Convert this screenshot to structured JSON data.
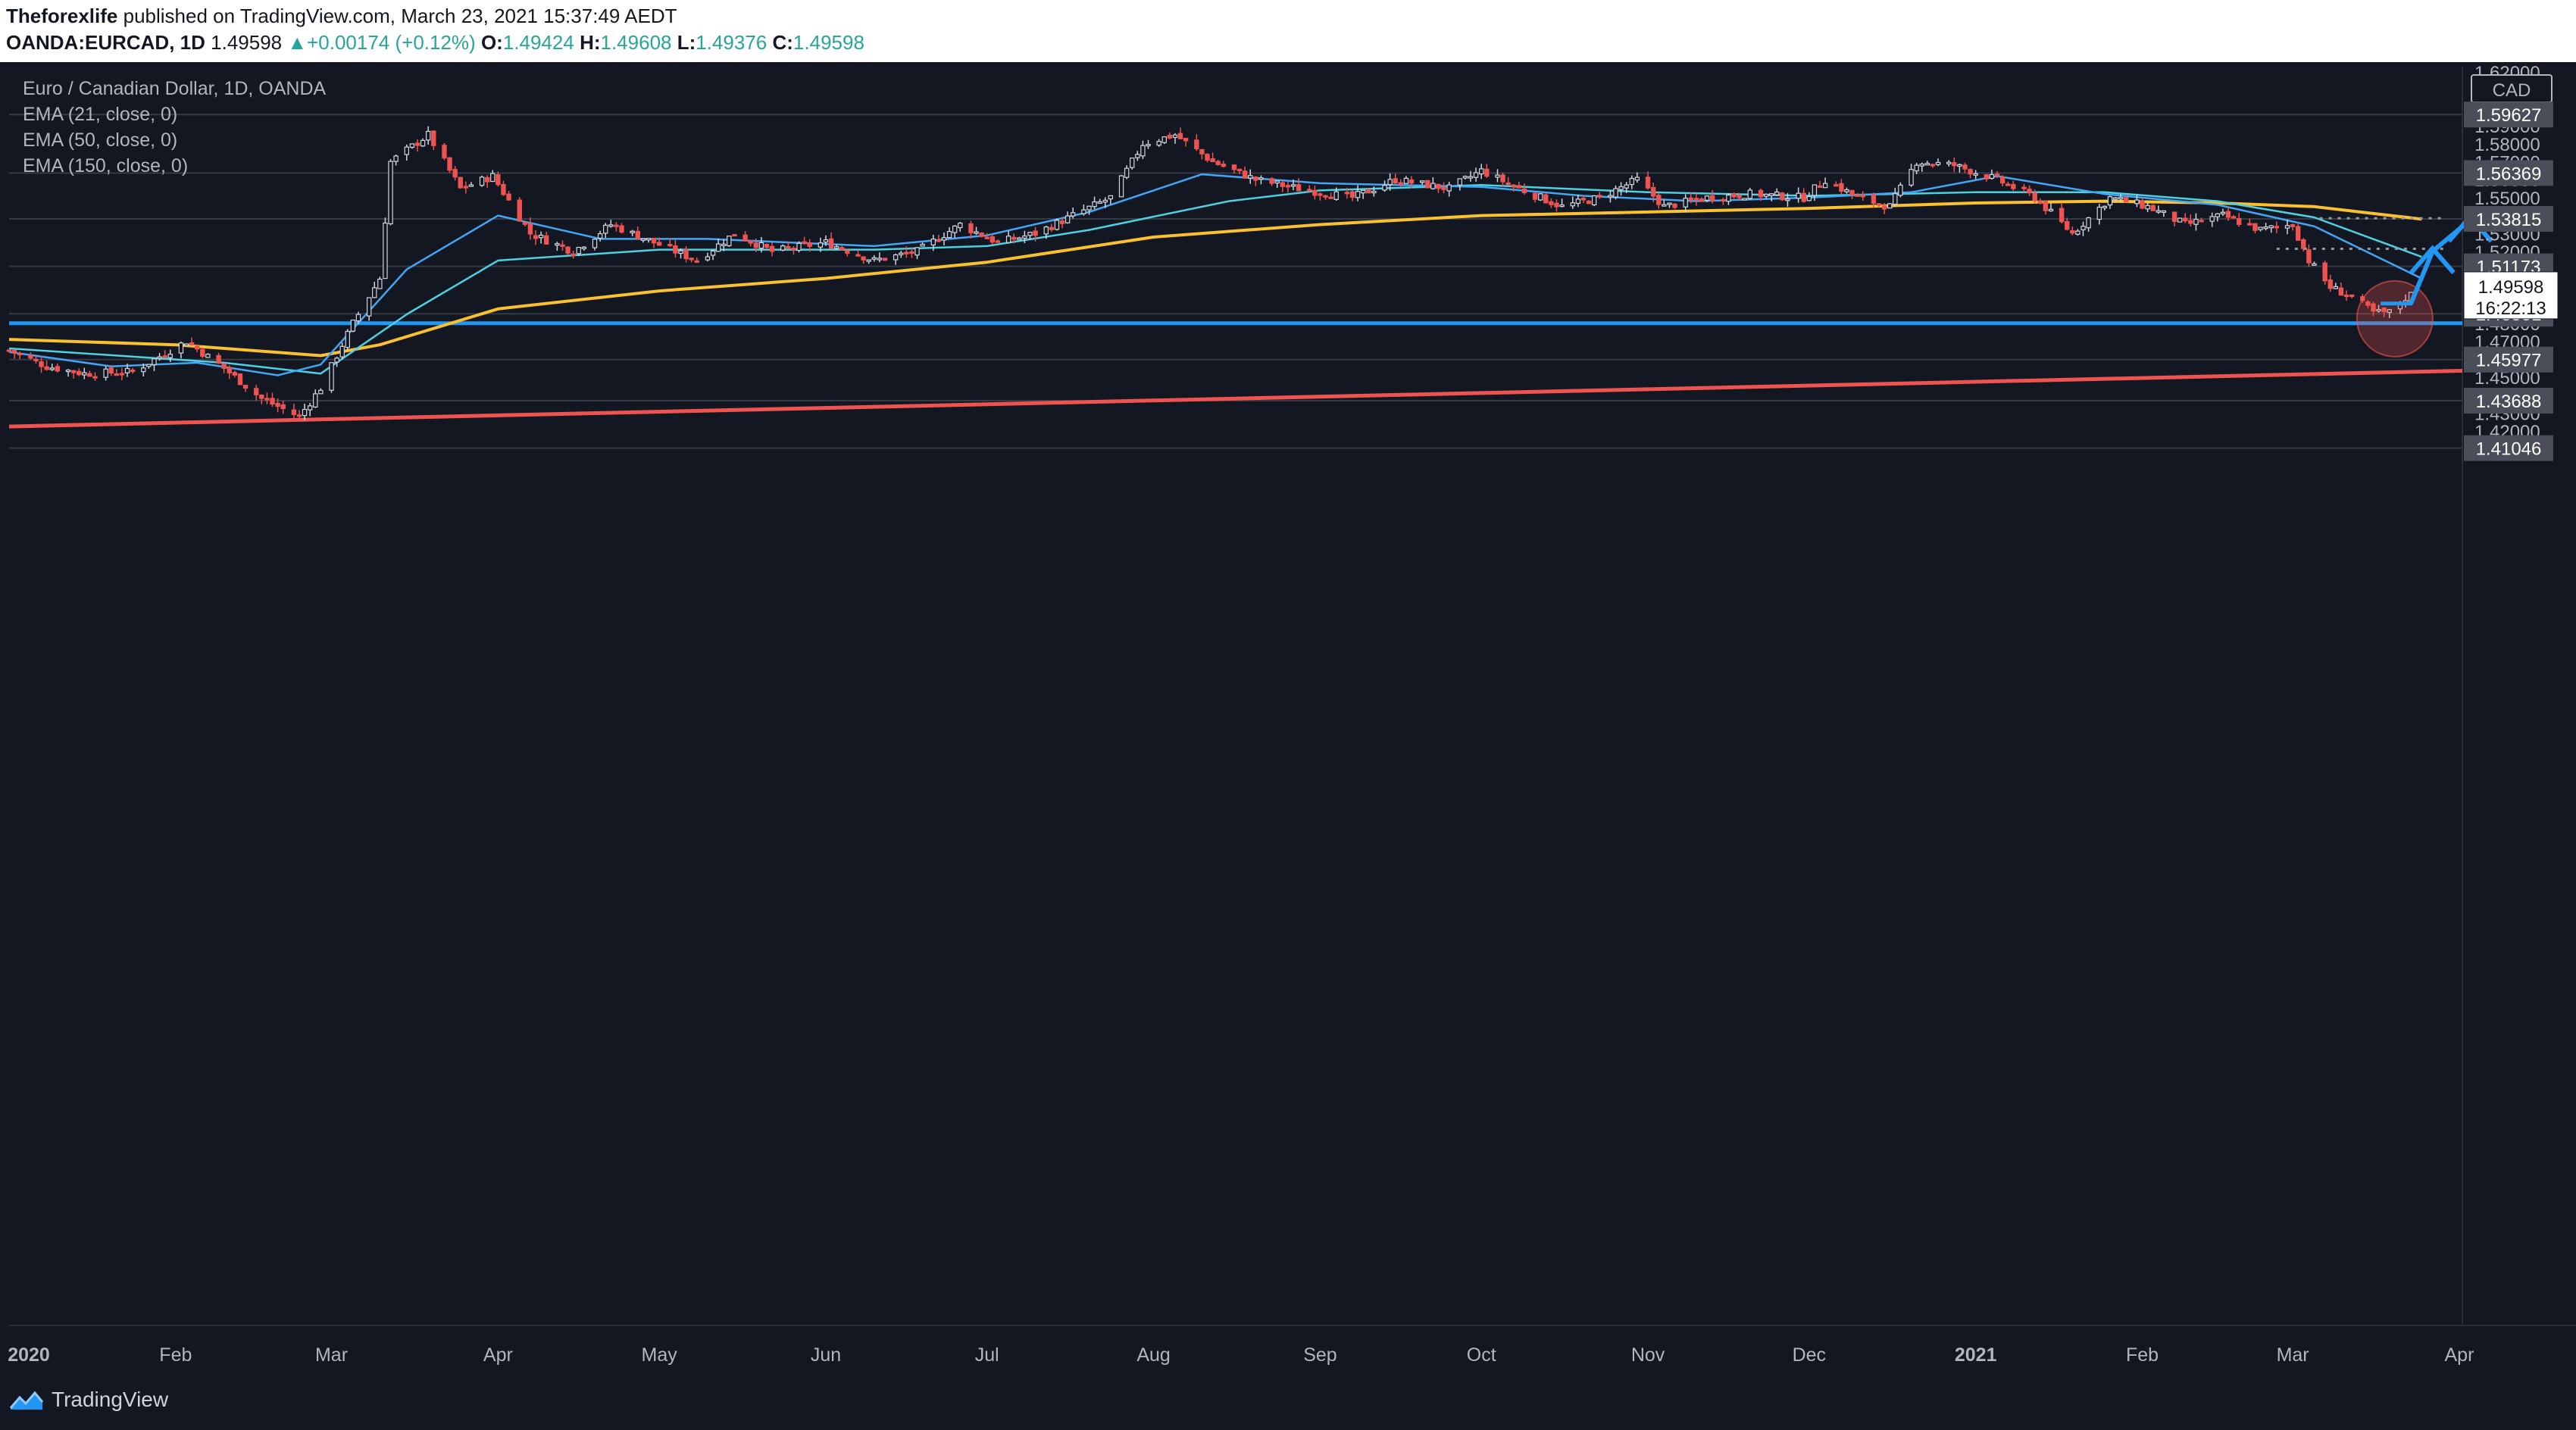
{
  "header": {
    "publisher": "Theforexlife",
    "published_text": "published on TradingView.com, March 23, 2021 15:37:49 AEDT",
    "symbol": "OANDA:EURCAD, 1D",
    "last": "1.49598",
    "change": "+0.00174 (+0.12%)",
    "o_label": "O:",
    "o": "1.49424",
    "h_label": "H:",
    "h": "1.49608",
    "l_label": "L:",
    "l": "1.49376",
    "c_label": "C:",
    "c": "1.49598"
  },
  "legend": {
    "title": "Euro / Canadian Dollar, 1D, OANDA",
    "ema21": "EMA (21, close, 0)",
    "ema50": "EMA (50, close, 0)",
    "ema150": "EMA (150, close, 0)"
  },
  "footer": {
    "brand": "TradingView"
  },
  "colors": {
    "background": "#131722",
    "up": "#d1d4dc",
    "down": "#ef5350",
    "ema21": "#42a5f5",
    "ema50": "#4dd0e1",
    "ema150": "#fbc02d",
    "support": "#2196f3",
    "trendline": "#ef5350",
    "arrow": "#2196f3"
  },
  "chart_data": {
    "type": "candlestick",
    "title": "Euro / Canadian Dollar, 1D, OANDA",
    "currency": "CAD",
    "ylim": [
      1.41,
      1.62
    ],
    "y_ticks": [
      1.42,
      1.43,
      1.44,
      1.45,
      1.46,
      1.47,
      1.48,
      1.49,
      1.5,
      1.51,
      1.52,
      1.53,
      1.54,
      1.55,
      1.56,
      1.57,
      1.58,
      1.59,
      1.6,
      1.61,
      1.62
    ],
    "y_tick_labels": [
      "1.42000",
      "1.43000",
      "1.44000",
      "1.45000",
      "1.46000",
      "1.47000",
      "1.48000",
      "1.49000",
      "1.50000",
      "1.51000",
      "1.52000",
      "1.53000",
      "1.54000",
      "1.55000",
      "1.56000",
      "1.57000",
      "1.58000",
      "1.59000",
      "1.60000",
      "1.61000",
      "1.62000"
    ],
    "x_ticks": [
      "2020",
      "Feb",
      "Mar",
      "Apr",
      "May",
      "Jun",
      "Jul",
      "Aug",
      "Sep",
      "Oct",
      "Nov",
      "Dec",
      "2021",
      "Feb",
      "Mar",
      "Apr"
    ],
    "x_range": [
      "2020-01-01",
      "2021-04-30"
    ],
    "price_levels": [
      {
        "label": "1.59627",
        "value": 1.59627
      },
      {
        "label": "1.56369",
        "value": 1.56369
      },
      {
        "label": "1.53815",
        "value": 1.53815
      },
      {
        "label": "1.51173",
        "value": 1.51173
      },
      {
        "label": "1.48531",
        "value": 1.48531
      },
      {
        "label": "1.45977",
        "value": 1.45977
      },
      {
        "label": "1.43688",
        "value": 1.43688
      },
      {
        "label": "1.41046",
        "value": 1.41046
      }
    ],
    "current_price": {
      "label": "1.49598",
      "value": 1.49598,
      "countdown": "16:22:13"
    },
    "support_line": 1.48,
    "trendline": {
      "start": [
        "2020-01-01",
        1.4225
      ],
      "end": [
        "2021-04-30",
        1.4555
      ]
    },
    "target_arrows": [
      {
        "from": [
          "2021-03-23",
          1.491
        ],
        "to": [
          "2021-03-27",
          1.52
        ]
      },
      {
        "to": [
          "2021-04-03",
          1.5375
        ]
      }
    ],
    "dotted_levels": [
      {
        "value": 1.5385,
        "from": "2021-03-06",
        "to": "2021-03-29"
      },
      {
        "value": 1.5215,
        "from": "2021-02-26",
        "to": "2021-03-29"
      }
    ],
    "highlight": {
      "date": "2021-03-20",
      "value": 1.4825
    },
    "series": [
      {
        "name": "EMA (21, close, 0)",
        "values": [
          [
            "2020-01-01",
            1.464
          ],
          [
            "2020-01-20",
            1.456
          ],
          [
            "2020-02-05",
            1.458
          ],
          [
            "2020-02-20",
            1.451
          ],
          [
            "2020-02-28",
            1.457
          ],
          [
            "2020-03-15",
            1.51
          ],
          [
            "2020-04-01",
            1.54
          ],
          [
            "2020-04-20",
            1.527
          ],
          [
            "2020-05-10",
            1.527
          ],
          [
            "2020-06-10",
            1.523
          ],
          [
            "2020-07-01",
            1.529
          ],
          [
            "2020-07-20",
            1.542
          ],
          [
            "2020-08-10",
            1.563
          ],
          [
            "2020-09-01",
            1.558
          ],
          [
            "2020-10-01",
            1.556
          ],
          [
            "2020-10-20",
            1.551
          ],
          [
            "2020-11-10",
            1.548
          ],
          [
            "2020-12-01",
            1.55
          ],
          [
            "2020-12-20",
            1.553
          ],
          [
            "2021-01-05",
            1.562
          ],
          [
            "2021-01-25",
            1.552
          ],
          [
            "2021-02-15",
            1.546
          ],
          [
            "2021-03-05",
            1.534
          ],
          [
            "2021-03-25",
            1.505
          ]
        ]
      },
      {
        "name": "EMA (50, close, 0)",
        "values": [
          [
            "2020-01-01",
            1.466
          ],
          [
            "2020-02-10",
            1.458
          ],
          [
            "2020-02-28",
            1.452
          ],
          [
            "2020-03-15",
            1.485
          ],
          [
            "2020-04-01",
            1.515
          ],
          [
            "2020-05-01",
            1.521
          ],
          [
            "2020-06-10",
            1.521
          ],
          [
            "2020-07-01",
            1.523
          ],
          [
            "2020-07-20",
            1.532
          ],
          [
            "2020-08-15",
            1.548
          ],
          [
            "2020-09-01",
            1.554
          ],
          [
            "2020-10-01",
            1.557
          ],
          [
            "2020-11-01",
            1.553
          ],
          [
            "2020-12-01",
            1.551
          ],
          [
            "2021-01-01",
            1.553
          ],
          [
            "2021-01-25",
            1.553
          ],
          [
            "2021-02-15",
            1.548
          ],
          [
            "2021-03-05",
            1.539
          ],
          [
            "2021-03-25",
            1.517
          ]
        ]
      },
      {
        "name": "EMA (150, close, 0)",
        "values": [
          [
            "2020-01-01",
            1.471
          ],
          [
            "2020-02-01",
            1.468
          ],
          [
            "2020-02-28",
            1.462
          ],
          [
            "2020-03-10",
            1.468
          ],
          [
            "2020-04-01",
            1.488
          ],
          [
            "2020-05-01",
            1.498
          ],
          [
            "2020-06-01",
            1.505
          ],
          [
            "2020-07-01",
            1.514
          ],
          [
            "2020-08-01",
            1.528
          ],
          [
            "2020-09-01",
            1.535
          ],
          [
            "2020-10-01",
            1.54
          ],
          [
            "2020-11-01",
            1.542
          ],
          [
            "2020-12-01",
            1.544
          ],
          [
            "2021-01-01",
            1.547
          ],
          [
            "2021-01-25",
            1.548
          ],
          [
            "2021-02-15",
            1.547
          ],
          [
            "2021-03-05",
            1.545
          ],
          [
            "2021-03-25",
            1.538
          ]
        ]
      }
    ],
    "candle_anchors": [
      [
        "2020-01-01",
        1.465
      ],
      [
        "2020-01-08",
        1.456
      ],
      [
        "2020-01-15",
        1.452
      ],
      [
        "2020-01-24",
        1.453
      ],
      [
        "2020-02-03",
        1.47
      ],
      [
        "2020-02-10",
        1.455
      ],
      [
        "2020-02-17",
        1.438
      ],
      [
        "2020-02-24",
        1.428
      ],
      [
        "2020-02-28",
        1.444
      ],
      [
        "2020-03-05",
        1.48
      ],
      [
        "2020-03-10",
        1.505
      ],
      [
        "2020-03-12",
        1.57
      ],
      [
        "2020-03-19",
        1.585
      ],
      [
        "2020-03-25",
        1.555
      ],
      [
        "2020-03-31",
        1.562
      ],
      [
        "2020-04-07",
        1.53
      ],
      [
        "2020-04-15",
        1.52
      ],
      [
        "2020-04-22",
        1.535
      ],
      [
        "2020-04-30",
        1.525
      ],
      [
        "2020-05-08",
        1.515
      ],
      [
        "2020-05-15",
        1.53
      ],
      [
        "2020-05-22",
        1.52
      ],
      [
        "2020-06-01",
        1.525
      ],
      [
        "2020-06-10",
        1.515
      ],
      [
        "2020-06-18",
        1.52
      ],
      [
        "2020-06-26",
        1.535
      ],
      [
        "2020-07-03",
        1.525
      ],
      [
        "2020-07-10",
        1.53
      ],
      [
        "2020-07-17",
        1.54
      ],
      [
        "2020-07-24",
        1.55
      ],
      [
        "2020-07-30",
        1.58
      ],
      [
        "2020-08-05",
        1.585
      ],
      [
        "2020-08-12",
        1.57
      ],
      [
        "2020-08-20",
        1.56
      ],
      [
        "2020-08-28",
        1.555
      ],
      [
        "2020-09-07",
        1.55
      ],
      [
        "2020-09-15",
        1.56
      ],
      [
        "2020-09-25",
        1.555
      ],
      [
        "2020-10-01",
        1.565
      ],
      [
        "2020-10-08",
        1.555
      ],
      [
        "2020-10-16",
        1.545
      ],
      [
        "2020-10-23",
        1.55
      ],
      [
        "2020-10-30",
        1.56
      ],
      [
        "2020-11-04",
        1.545
      ],
      [
        "2020-11-12",
        1.55
      ],
      [
        "2020-11-20",
        1.552
      ],
      [
        "2020-11-30",
        1.55
      ],
      [
        "2020-12-04",
        1.56
      ],
      [
        "2020-12-10",
        1.55
      ],
      [
        "2020-12-16",
        1.545
      ],
      [
        "2020-12-21",
        1.57
      ],
      [
        "2020-12-28",
        1.568
      ],
      [
        "2021-01-05",
        1.56
      ],
      [
        "2021-01-12",
        1.55
      ],
      [
        "2021-01-19",
        1.53
      ],
      [
        "2021-01-26",
        1.55
      ],
      [
        "2021-02-02",
        1.545
      ],
      [
        "2021-02-09",
        1.535
      ],
      [
        "2021-02-16",
        1.54
      ],
      [
        "2021-02-23",
        1.532
      ],
      [
        "2021-03-01",
        1.535
      ],
      [
        "2021-03-04",
        1.515
      ],
      [
        "2021-03-08",
        1.5
      ],
      [
        "2021-03-12",
        1.495
      ],
      [
        "2021-03-16",
        1.486
      ],
      [
        "2021-03-19",
        1.486
      ],
      [
        "2021-03-22",
        1.4942
      ],
      [
        "2021-03-23",
        1.49598
      ]
    ]
  }
}
